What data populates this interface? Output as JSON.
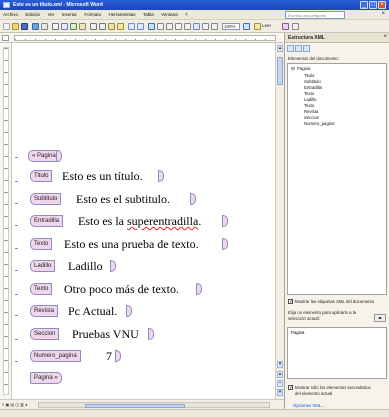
{
  "window": {
    "title": "Esto es un título.xml - Microsoft Word",
    "controls": [
      "_",
      "□",
      "×"
    ]
  },
  "menubar": {
    "items": [
      "Archivo",
      "Edición",
      "Ver",
      "Insertar",
      "Formato",
      "Herramientas",
      "Tabla",
      "Ventana",
      "?"
    ],
    "ask_placeholder": "Escriba una pregunta",
    "close": "×"
  },
  "toolbar": {
    "zoom": "100%",
    "read_label": "Leer"
  },
  "document": {
    "root_tag": "Pagina",
    "elements": [
      {
        "tag": "Titulo",
        "text": "Esto es un título."
      },
      {
        "tag": "Subtitulo",
        "text": "Esto es el subtitulo."
      },
      {
        "tag": "Entradilla",
        "text": "Esto es la superentradilla."
      },
      {
        "tag": "Texto",
        "text": "Esto es una prueba de texto."
      },
      {
        "tag": "Ladillo",
        "text": "Ladillo"
      },
      {
        "tag": "Texto",
        "text": "Otro poco más de texto."
      },
      {
        "tag": "Revista",
        "text": "Pc Actual."
      },
      {
        "tag": "Seccion",
        "text": "Pruebas VNU"
      },
      {
        "tag": "Numero_pagina",
        "text": "7"
      }
    ]
  },
  "panel": {
    "title": "Estructura XML",
    "close": "×",
    "tree_label": "Elementos del documento:",
    "tree_root": "Pagina",
    "tree_children": [
      "Titulo",
      "Subtitulo",
      "Entradilla",
      "Texto",
      "Ladillo",
      "Texto",
      "Revista",
      "Seccion",
      "Numero_pagina"
    ],
    "show_tags_label": "Mostrar las etiquetas XML del documento",
    "apply_label_1": "Elija un elemento para aplicarlo a la",
    "apply_label_2": "selección actual:",
    "list_items": [
      "Pagina"
    ],
    "only_children_label_1": "Mostrar sólo los elementos secundarios",
    "only_children_label_2": "del elemento actual",
    "options_link": "Opciones XML..."
  },
  "statusbar": {
    "view_buttons": "≡ ▣ ▤ ◫ ▥ ◂"
  }
}
